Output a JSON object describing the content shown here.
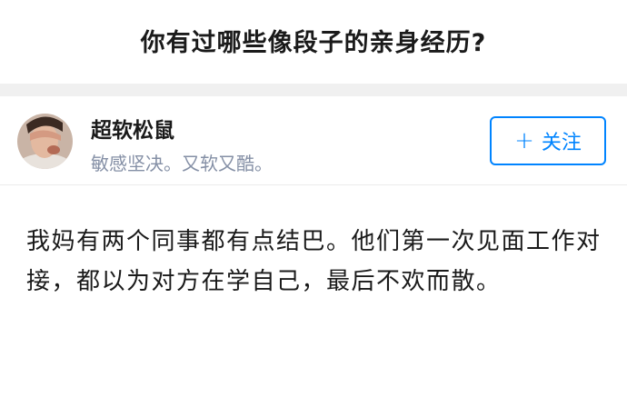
{
  "question": {
    "title": "你有过哪些像段子的亲身经历?"
  },
  "author": {
    "name": "超软松鼠",
    "bio": "敏感坚决。又软又酷。",
    "avatar_icon": "user-avatar-icon"
  },
  "follow_button": {
    "label": "关注",
    "icon": "plus-icon",
    "color": "#0084ff"
  },
  "answer": {
    "text": "我妈有两个同事都有点结巴。他们第一次见面工作对接，都以为对方在学自己，最后不欢而散。"
  }
}
